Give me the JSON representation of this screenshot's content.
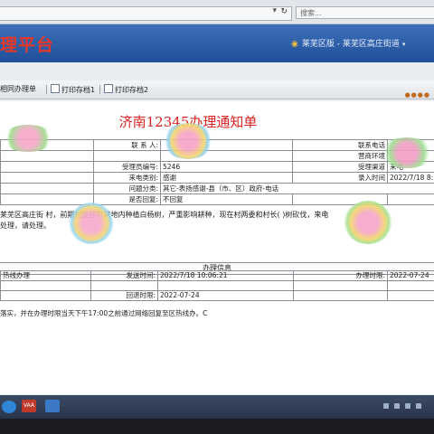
{
  "browser": {
    "search_placeholder": "搜索..."
  },
  "header": {
    "logo_text": "理平台",
    "user_area": "莱芜区版 - 莱芜区高庄街道"
  },
  "tabs": [
    {
      "label": "相同办理单"
    },
    {
      "label": "打印存档1"
    },
    {
      "label": "打印存档2"
    }
  ],
  "form": {
    "title": "济南12345办理通知单",
    "contact_label": "联 系 人:",
    "contact_phone_label": "联系电话",
    "belong_label": "营商环境",
    "channel_label": "受理渠道",
    "channel_value": "来电",
    "accept_no_label": "受理员编号:",
    "accept_no_value": "5246",
    "caller_type_label": "来电类别:",
    "caller_type_value": "感谢",
    "input_time_label": "录入时间",
    "input_time_value": "2022/7/18 8:",
    "category_label": "问题分类:",
    "category_value": "其它-表扬感谢-县（市、区）政府-电话",
    "reply_label": "是否回复:",
    "reply_value": "不回复",
    "desc_line1": "莱芜区高庄街                    村，前期村民在可耕地内种植白杨树，严重影响耕种，现在村两委和村长(                     )树砍伐，来电",
    "desc_line2": "处理，请处理。"
  },
  "process": {
    "section_title": "办理信息",
    "dept_value": "热线办理",
    "send_time_label": "发送时间:",
    "send_time_value": "2022/7/18 10:06:21",
    "handle_time_label": "办理时限:",
    "handle_time_value": "2022-07-24",
    "return_time_label": "回退时限:",
    "return_time_value": "2022-07-24",
    "remark": "落实，并在办理时限当天下午17:00之前通过网络回复至区热线办。C"
  },
  "taskbar": {
    "app_label": "VAA"
  },
  "colors": {
    "header_blue": "#2a5aa6",
    "title_red": "#d8201e",
    "logo_red": "#e63828"
  }
}
